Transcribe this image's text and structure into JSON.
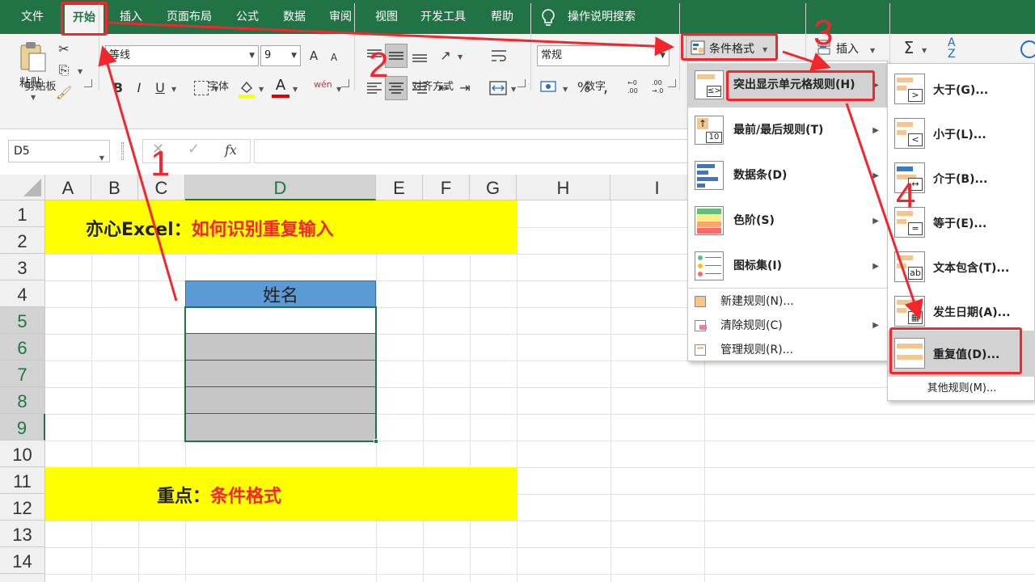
{
  "tabs": [
    "文件",
    "开始",
    "插入",
    "页面布局",
    "公式",
    "数据",
    "审阅",
    "视图",
    "开发工具",
    "帮助"
  ],
  "tell_me": "操作说明搜索",
  "ribbon": {
    "paste": "粘贴",
    "clipboard_label": "剪贴板",
    "font_name": "等线",
    "font_size": "9",
    "grow": "A",
    "shrink": "A",
    "bold": "B",
    "italic": "I",
    "underline": "U",
    "font_color": "A",
    "phonetic": "wén",
    "font_label": "字体",
    "align_label": "对齐方式",
    "number_format": "常规",
    "percent": "%",
    "comma": ",",
    "number_label": "数字",
    "cond_format": "条件格式",
    "insert": "插入",
    "sum": "Σ",
    "sort": "A",
    "sort2": "Z"
  },
  "name_box": "D5",
  "fx": "fx",
  "columns": [
    "A",
    "B",
    "C",
    "D",
    "E",
    "F",
    "G",
    "H",
    "I"
  ],
  "rows": [
    "1",
    "2",
    "3",
    "4",
    "5",
    "6",
    "7",
    "8",
    "9",
    "10",
    "11",
    "12",
    "13",
    "14"
  ],
  "sheet": {
    "title_black": "亦心Excel：",
    "title_red": "如何识别重复输入",
    "header": "姓名",
    "key_black": "重点：",
    "key_red": "条件格式"
  },
  "menu": {
    "items": [
      {
        "label": "突出显示单元格规则(H)"
      },
      {
        "label": "最前/最后规则(T)"
      },
      {
        "label": "数据条(D)"
      },
      {
        "label": "色阶(S)"
      },
      {
        "label": "图标集(I)"
      }
    ],
    "small": [
      {
        "label": "新建规则(N)..."
      },
      {
        "label": "清除规则(C)"
      },
      {
        "label": "管理规则(R)..."
      }
    ]
  },
  "submenu": {
    "items": [
      {
        "label": "大于(G)...",
        "glyph": ">"
      },
      {
        "label": "小于(L)...",
        "glyph": "<"
      },
      {
        "label": "介于(B)...",
        "glyph": "↔"
      },
      {
        "label": "等于(E)...",
        "glyph": "="
      },
      {
        "label": "文本包含(T)...",
        "glyph": "ab"
      },
      {
        "label": "发生日期(A)...",
        "glyph": "▦"
      },
      {
        "label": "重复值(D)...",
        "glyph": ""
      }
    ],
    "other": "其他规则(M)..."
  },
  "steps": [
    "1",
    "2",
    "3",
    "4"
  ],
  "icon10": "10",
  "colors": {
    "excel_green": "#217346",
    "highlight_yellow": "#ffff00",
    "header_blue": "#5b9bd5",
    "annotation_red": "#f2262c"
  }
}
